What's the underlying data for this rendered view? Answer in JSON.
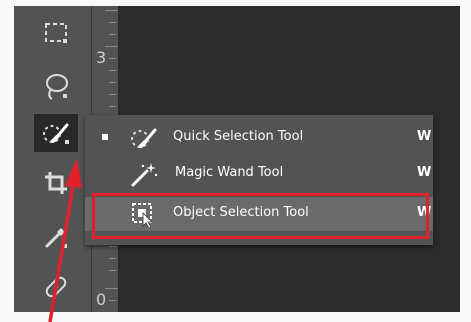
{
  "toolbar": {
    "tools": [
      {
        "icon": "rectangular-marquee-icon"
      },
      {
        "icon": "lasso-icon"
      },
      {
        "icon": "quick-selection-icon",
        "active": true
      },
      {
        "icon": "crop-icon"
      },
      {
        "icon": "eyedropper-icon"
      },
      {
        "icon": "healing-brush-icon"
      }
    ]
  },
  "ruler": {
    "labels": [
      "3",
      "0"
    ]
  },
  "flyout": {
    "items": [
      {
        "label": "Quick Selection Tool",
        "shortcut": "W",
        "selected": true,
        "icon": "quick-selection-icon"
      },
      {
        "label": "Magic Wand Tool",
        "shortcut": "W",
        "selected": false,
        "icon": "magic-wand-icon"
      },
      {
        "label": "Object Selection Tool",
        "shortcut": "W",
        "selected": false,
        "highlighted": true,
        "icon": "object-selection-icon"
      }
    ]
  },
  "annotation": {
    "box_color": "#e0202a",
    "arrow_color": "#e0202a"
  }
}
